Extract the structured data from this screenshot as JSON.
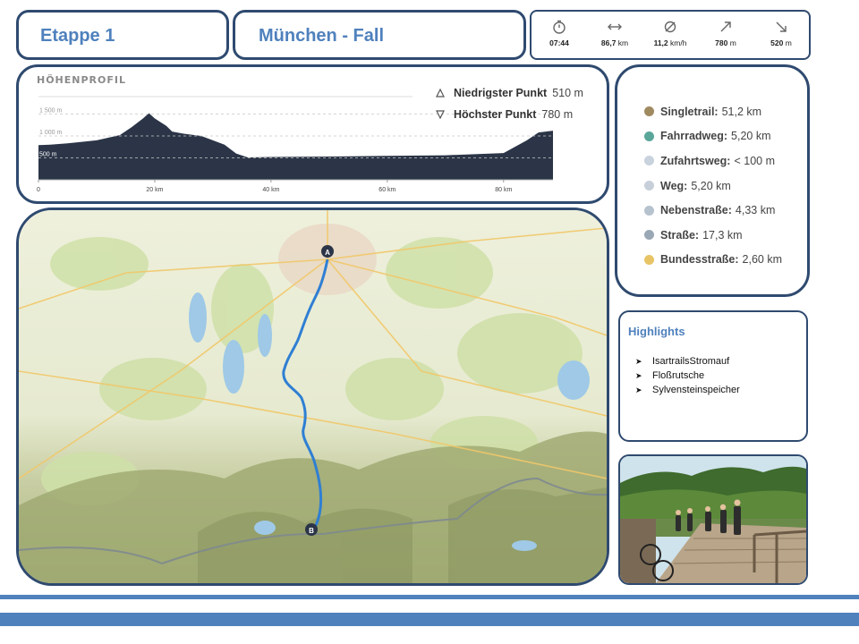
{
  "stage": {
    "label": "Etappe 1"
  },
  "route": {
    "title": "München - Fall"
  },
  "stats": [
    {
      "icon": "stopwatch-icon",
      "value": "07:44",
      "unit": ""
    },
    {
      "icon": "distance-arrows-icon",
      "value": "86,7",
      "unit": " km"
    },
    {
      "icon": "average-speed-icon",
      "value": "11,2",
      "unit": " km/h"
    },
    {
      "icon": "ascent-arrow-icon",
      "value": "780",
      "unit": " m"
    },
    {
      "icon": "descent-arrow-icon",
      "value": "520",
      "unit": " m"
    }
  ],
  "profile": {
    "title": "HÖHENPROFIL",
    "lowest": {
      "label": "Niedrigster Punkt",
      "value": "510 m"
    },
    "highest": {
      "label": "Höchster Punkt",
      "value": "780 m"
    },
    "y_ticks": [
      "500 m",
      "1 000 m",
      "1 500 m"
    ],
    "x_ticks": [
      "0",
      "20 km",
      "40 km",
      "60 km",
      "80 km"
    ]
  },
  "chart_data": {
    "type": "area",
    "title": "HÖHENPROFIL",
    "xlabel": "",
    "ylabel": "",
    "x": [
      0,
      2,
      5,
      10,
      14,
      16,
      18,
      19,
      20,
      22,
      23,
      25,
      28,
      32,
      34,
      36,
      40,
      50,
      60,
      70,
      80,
      84,
      86,
      88.5
    ],
    "y": [
      790,
      800,
      830,
      900,
      1020,
      1200,
      1400,
      1520,
      1400,
      1230,
      1100,
      1050,
      1000,
      800,
      600,
      510,
      520,
      530,
      545,
      560,
      610,
      900,
      1080,
      1120
    ],
    "x_ticks": [
      0,
      20,
      40,
      60,
      80
    ],
    "y_ticks": [
      500,
      1000,
      1500
    ],
    "xlim": [
      0,
      88.5
    ],
    "ylim": [
      0,
      2000
    ],
    "fill_color": "#2b3547",
    "grid": true
  },
  "legend": [
    {
      "name": "Singletrail:",
      "value": "51,2 km",
      "color": "#a08a60"
    },
    {
      "name": "Fahrradweg:",
      "value": "5,20 km",
      "color": "#5aa69a"
    },
    {
      "name": "Zufahrtsweg:",
      "value": "< 100 m",
      "color": "#c9d3de"
    },
    {
      "name": "Weg:",
      "value": "5,20 km",
      "color": "#c7d0da"
    },
    {
      "name": "Nebenstraße:",
      "value": "4,33 km",
      "color": "#b6c2cd"
    },
    {
      "name": "Straße:",
      "value": "17,3 km",
      "color": "#9aa8b5"
    },
    {
      "name": "Bundesstraße:",
      "value": "2,60 km",
      "color": "#e8c466"
    }
  ],
  "highlights": {
    "title": "Highlights",
    "items": [
      "IsartrailsStromauf",
      "Floßrutsche",
      "Sylvensteinspeicher"
    ]
  },
  "map": {
    "start_marker": "A",
    "end_marker": "B",
    "route_color": "#2f7fd3"
  },
  "colors": {
    "accent": "#4f81bd",
    "border": "#2f4a6f"
  }
}
